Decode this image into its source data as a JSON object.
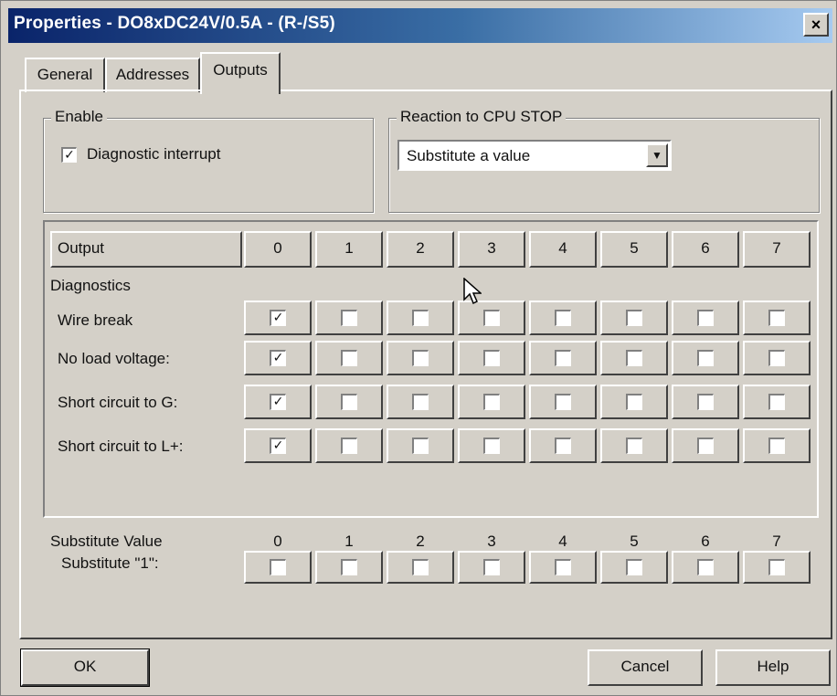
{
  "window": {
    "title": "Properties - DO8xDC24V/0.5A - (R-/S5)",
    "close_glyph": "×"
  },
  "tabs": [
    {
      "label": "General",
      "active": false
    },
    {
      "label": "Addresses",
      "active": false
    },
    {
      "label": "Outputs",
      "active": true
    }
  ],
  "enable": {
    "legend": "Enable",
    "diagnostic_interrupt_label": "Diagnostic interrupt",
    "diagnostic_interrupt_checked": true
  },
  "reaction": {
    "legend": "Reaction to CPU STOP",
    "selected": "Substitute a value"
  },
  "table": {
    "output_header": "Output",
    "columns": [
      "0",
      "1",
      "2",
      "3",
      "4",
      "5",
      "6",
      "7"
    ],
    "section_label": "Diagnostics",
    "rows": [
      {
        "label": "Wire break",
        "checked": [
          true,
          false,
          false,
          false,
          false,
          false,
          false,
          false
        ]
      },
      {
        "label": "No load voltage:",
        "checked": [
          true,
          false,
          false,
          false,
          false,
          false,
          false,
          false
        ]
      },
      {
        "label": "Short circuit to G:",
        "checked": [
          true,
          false,
          false,
          false,
          false,
          false,
          false,
          false
        ]
      },
      {
        "label": "Short circuit to L+:",
        "checked": [
          true,
          false,
          false,
          false,
          false,
          false,
          false,
          false
        ]
      }
    ]
  },
  "substitute": {
    "section_label": "Substitute Value",
    "row_label": "Substitute \"1\":",
    "columns": [
      "0",
      "1",
      "2",
      "3",
      "4",
      "5",
      "6",
      "7"
    ],
    "checked": [
      false,
      false,
      false,
      false,
      false,
      false,
      false,
      false
    ]
  },
  "buttons": {
    "ok": "OK",
    "cancel": "Cancel",
    "help": "Help"
  },
  "check_glyph": "✓",
  "dropdown_glyph": "▼"
}
